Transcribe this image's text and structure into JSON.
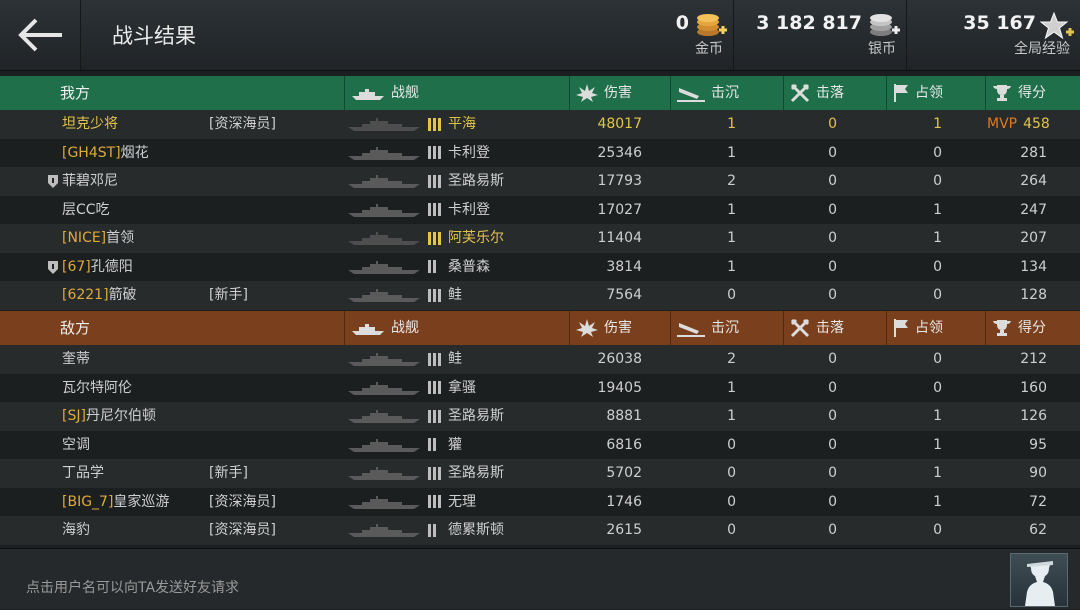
{
  "header": {
    "title": "战斗结果",
    "gold": {
      "value": "0",
      "label": "金币"
    },
    "silver": {
      "value": "3 182 817",
      "label": "银币"
    },
    "xp": {
      "value": "35 167",
      "label": "全局经验"
    }
  },
  "columns": {
    "ally_label": "我方",
    "enemy_label": "敌方",
    "ship": "战舰",
    "damage": "伤害",
    "sunk": "击沉",
    "downed": "击落",
    "capture": "占领",
    "score": "得分"
  },
  "allies": [
    {
      "tag": "",
      "name": "坦克少将",
      "gold": true,
      "badge": false,
      "title": "[资深海员]",
      "tier": 3,
      "tier_gold": true,
      "ship": "平海",
      "damage": "48017",
      "sunk": "1",
      "downed": "0",
      "capture": "1",
      "score": "458",
      "mvp": "MVP"
    },
    {
      "tag": "[GH4ST]",
      "name": "烟花",
      "gold": false,
      "badge": false,
      "title": "",
      "tier": 3,
      "tier_gold": false,
      "ship": "卡利登",
      "damage": "25346",
      "sunk": "1",
      "downed": "0",
      "capture": "0",
      "score": "281",
      "mvp": ""
    },
    {
      "tag": "",
      "name": "菲碧邓尼",
      "gold": false,
      "badge": true,
      "title": "",
      "tier": 3,
      "tier_gold": false,
      "ship": "圣路易斯",
      "damage": "17793",
      "sunk": "2",
      "downed": "0",
      "capture": "0",
      "score": "264",
      "mvp": ""
    },
    {
      "tag": "",
      "name": "层CC吃",
      "gold": false,
      "badge": false,
      "title": "",
      "tier": 3,
      "tier_gold": false,
      "ship": "卡利登",
      "damage": "17027",
      "sunk": "1",
      "downed": "0",
      "capture": "1",
      "score": "247",
      "mvp": ""
    },
    {
      "tag": "[NICE]",
      "name": "首领",
      "gold": false,
      "badge": false,
      "title": "",
      "tier": 3,
      "tier_gold": true,
      "ship": "阿芙乐尔",
      "damage": "11404",
      "sunk": "1",
      "downed": "0",
      "capture": "1",
      "score": "207",
      "mvp": ""
    },
    {
      "tag": "[67]",
      "name": "孔德阳",
      "gold": false,
      "badge": true,
      "title": "",
      "tier": 2,
      "tier_gold": false,
      "ship": "桑普森",
      "damage": "3814",
      "sunk": "1",
      "downed": "0",
      "capture": "0",
      "score": "134",
      "mvp": ""
    },
    {
      "tag": "[6221]",
      "name": "箭破",
      "gold": false,
      "badge": false,
      "title": "[新手]",
      "tier": 3,
      "tier_gold": false,
      "ship": "鲑",
      "damage": "7564",
      "sunk": "0",
      "downed": "0",
      "capture": "0",
      "score": "128",
      "mvp": ""
    }
  ],
  "enemies": [
    {
      "tag": "",
      "name": "奎蒂",
      "badge": false,
      "title": "",
      "tier": 3,
      "ship": "鲑",
      "damage": "26038",
      "sunk": "2",
      "downed": "0",
      "capture": "0",
      "score": "212"
    },
    {
      "tag": "",
      "name": "瓦尔特阿伦",
      "badge": false,
      "title": "",
      "tier": 3,
      "ship": "拿骚",
      "damage": "19405",
      "sunk": "1",
      "downed": "0",
      "capture": "0",
      "score": "160"
    },
    {
      "tag": "[SJ]",
      "name": "丹尼尔伯顿",
      "badge": false,
      "title": "",
      "tier": 3,
      "ship": "圣路易斯",
      "damage": "8881",
      "sunk": "1",
      "downed": "0",
      "capture": "1",
      "score": "126"
    },
    {
      "tag": "",
      "name": "空调",
      "badge": false,
      "title": "",
      "tier": 2,
      "ship": "獾",
      "damage": "6816",
      "sunk": "0",
      "downed": "0",
      "capture": "1",
      "score": "95"
    },
    {
      "tag": "",
      "name": "丁品学",
      "badge": false,
      "title": "[新手]",
      "tier": 3,
      "ship": "圣路易斯",
      "damage": "5702",
      "sunk": "0",
      "downed": "0",
      "capture": "1",
      "score": "90"
    },
    {
      "tag": "[BIG_7]",
      "name": "皇家巡游",
      "badge": false,
      "title": "[资深海员]",
      "tier": 3,
      "ship": "无理",
      "damage": "1746",
      "sunk": "0",
      "downed": "0",
      "capture": "1",
      "score": "72"
    },
    {
      "tag": "",
      "name": "海豹",
      "badge": false,
      "title": "[资深海员]",
      "tier": 2,
      "ship": "德累斯顿",
      "damage": "2615",
      "sunk": "0",
      "downed": "0",
      "capture": "0",
      "score": "62"
    }
  ],
  "footer": {
    "hint": "点击用户名可以向TA发送好友请求"
  },
  "colors": {
    "ally_header": "#1e6f4a",
    "enemy_header": "#7a3f1c",
    "gold_text": "#e3c44a",
    "mvp": "#e07a1e",
    "tag": "#e0a93a"
  }
}
